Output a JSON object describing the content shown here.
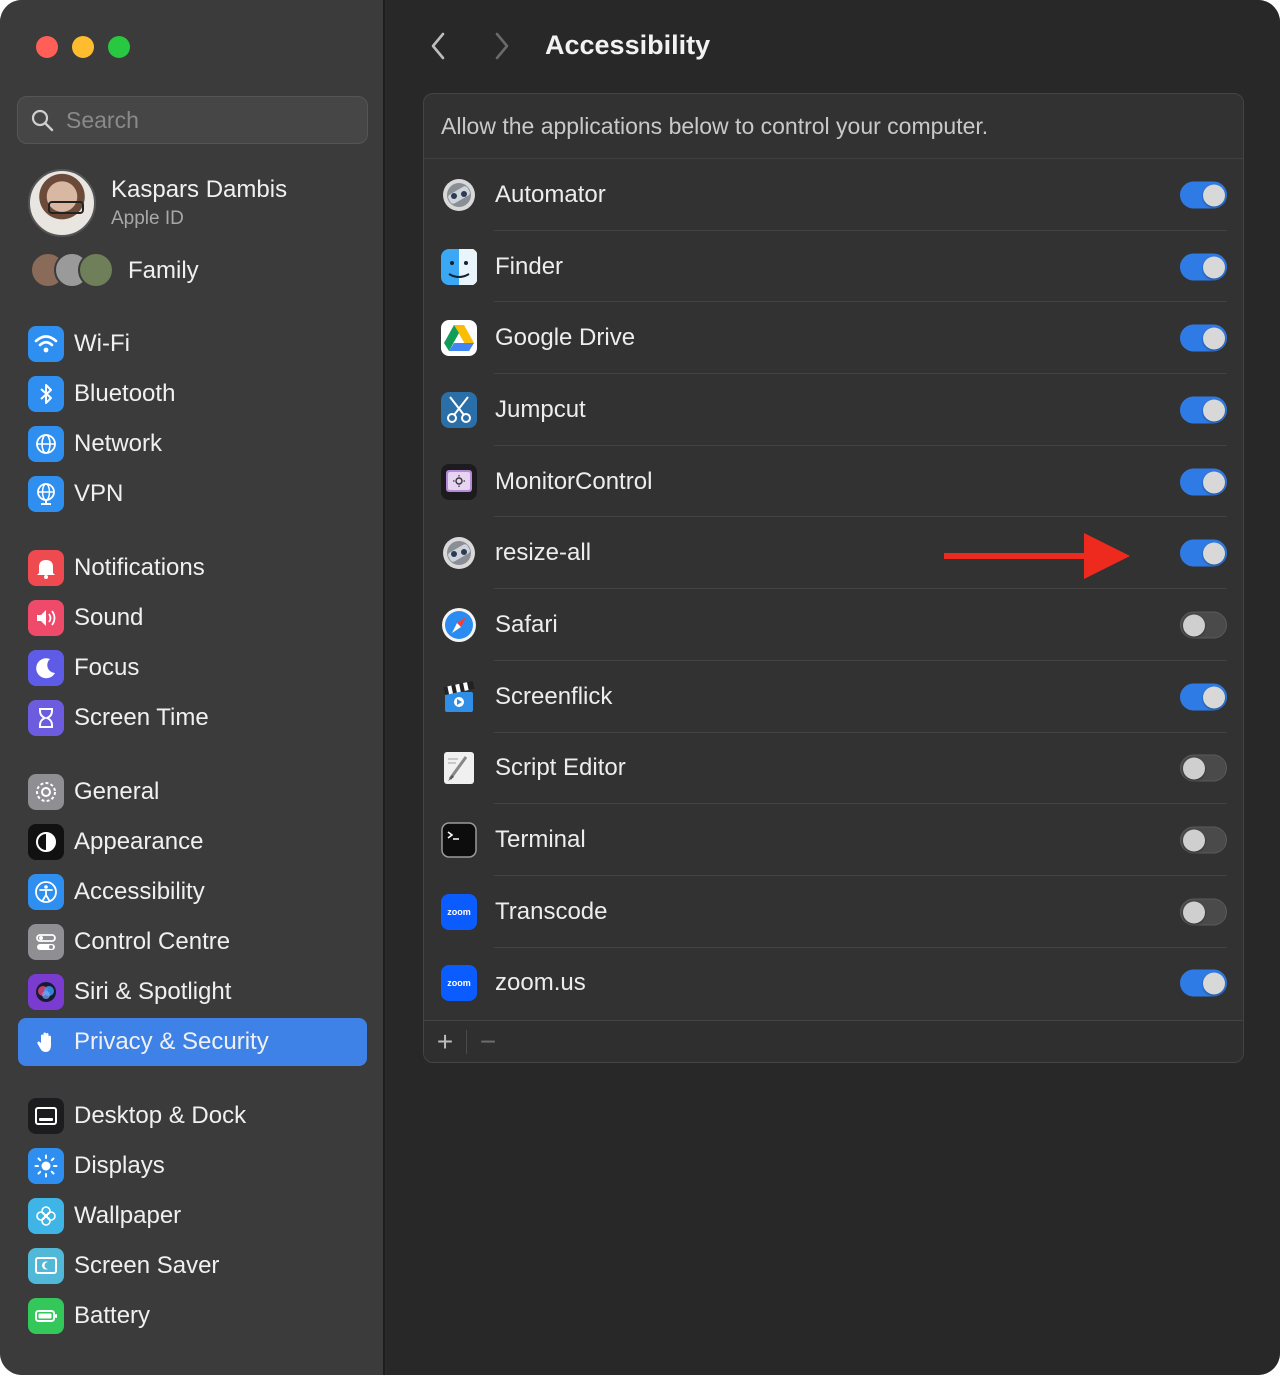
{
  "window": {
    "traffic_lights": [
      "close",
      "minimize",
      "zoom"
    ]
  },
  "sidebar": {
    "search": {
      "placeholder": "Search",
      "value": ""
    },
    "profile": {
      "name": "Kaspars Dambis",
      "subtitle": "Apple ID"
    },
    "family": {
      "label": "Family"
    },
    "items": [
      {
        "label": "Wi-Fi",
        "icon": "wifi-icon",
        "color": "#2f8ff0"
      },
      {
        "label": "Bluetooth",
        "icon": "bluetooth-icon",
        "color": "#2f8ff0"
      },
      {
        "label": "Network",
        "icon": "globe-icon",
        "color": "#2f8ff0"
      },
      {
        "label": "VPN",
        "icon": "vpn-globe-icon",
        "color": "#2f8ff0"
      },
      {
        "label": "Notifications",
        "icon": "bell-icon",
        "color": "#ef4a4f"
      },
      {
        "label": "Sound",
        "icon": "speaker-icon",
        "color": "#ef4a6a"
      },
      {
        "label": "Focus",
        "icon": "moon-icon",
        "color": "#5e5ce6"
      },
      {
        "label": "Screen Time",
        "icon": "hourglass-icon",
        "color": "#6d5be0"
      },
      {
        "label": "General",
        "icon": "gear-icon",
        "color": "#8e8e93"
      },
      {
        "label": "Appearance",
        "icon": "appearance-icon",
        "color": "#111111"
      },
      {
        "label": "Accessibility",
        "icon": "accessibility-icon",
        "color": "#2f8ff0"
      },
      {
        "label": "Control Centre",
        "icon": "toggles-icon",
        "color": "#8e8e93"
      },
      {
        "label": "Siri & Spotlight",
        "icon": "siri-icon",
        "color": "#7a3bd0"
      },
      {
        "label": "Privacy & Security",
        "icon": "hand-icon",
        "color": "#3e82e8",
        "selected": true
      },
      {
        "label": "Desktop & Dock",
        "icon": "dock-icon",
        "color": "#1c1c1e"
      },
      {
        "label": "Displays",
        "icon": "sun-icon",
        "color": "#2f8ff0"
      },
      {
        "label": "Wallpaper",
        "icon": "flower-icon",
        "color": "#3fb4e6"
      },
      {
        "label": "Screen Saver",
        "icon": "screensaver-icon",
        "color": "#52b8d8"
      },
      {
        "label": "Battery",
        "icon": "battery-icon",
        "color": "#34c759"
      }
    ]
  },
  "main": {
    "title": "Accessibility",
    "description": "Allow the applications below to control your computer.",
    "apps": [
      {
        "name": "Automator",
        "icon": "automator-icon",
        "enabled": true
      },
      {
        "name": "Finder",
        "icon": "finder-icon",
        "enabled": true
      },
      {
        "name": "Google Drive",
        "icon": "google-drive-icon",
        "enabled": true
      },
      {
        "name": "Jumpcut",
        "icon": "scissors-icon",
        "enabled": true
      },
      {
        "name": "MonitorControl",
        "icon": "monitor-icon",
        "enabled": true
      },
      {
        "name": "resize-all",
        "icon": "automator-icon",
        "enabled": true
      },
      {
        "name": "Safari",
        "icon": "compass-icon",
        "enabled": false
      },
      {
        "name": "Screenflick",
        "icon": "clapperboard-icon",
        "enabled": true
      },
      {
        "name": "Script Editor",
        "icon": "script-icon",
        "enabled": false
      },
      {
        "name": "Terminal",
        "icon": "terminal-icon",
        "enabled": false
      },
      {
        "name": "Transcode",
        "icon": "zoom-icon",
        "enabled": false
      },
      {
        "name": "zoom.us",
        "icon": "zoom-icon",
        "enabled": true
      }
    ],
    "footer": {
      "add": "+",
      "remove": "−"
    },
    "accent_color": "#2f7be6",
    "annotation_color": "#ee2a1e"
  }
}
